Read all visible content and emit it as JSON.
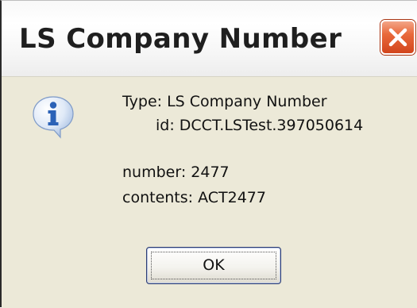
{
  "dialog": {
    "title": "LS Company Number",
    "icon": "info-icon",
    "close_icon": "close-icon",
    "message": {
      "type_line": "Type: LS Company Number",
      "id_line": "id: DCCT.LSTest.397050614",
      "number_line": "number: 2477",
      "contents_line": "contents: ACT2477"
    },
    "ok_label": "OK"
  },
  "colors": {
    "dialog_background": "#ece9d8",
    "close_button": "#e2582a",
    "info_icon_blue": "#2b62b7"
  }
}
